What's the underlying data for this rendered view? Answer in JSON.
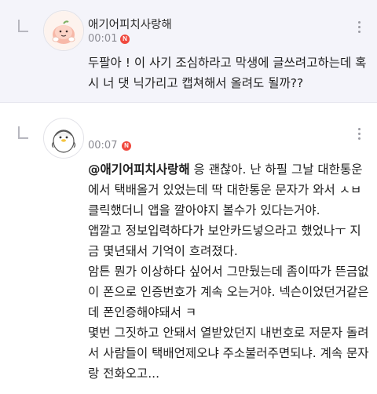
{
  "comments": [
    {
      "nickname": "애기어피치사랑해",
      "time": "00:01",
      "badge": "N",
      "text": "두팔아 ! 이 사기 조심하라고 막생에 글쓰려고하는데 혹시 너 댓 닉가리고 캡쳐해서 올려도 될까??",
      "avatar": "peach-character-avatar"
    },
    {
      "nickname": "",
      "time": "00:07",
      "badge": "N",
      "mention": "@애기어피치사랑해",
      "text": "  응 괜찮아. 난 하필 그날 대한통운에서 택배올거 있었는데 딱 대한통운 문자가 와서 ㅅㅂ 클릭했더니 앱을 깔아야지 볼수가 있다는거야.\n앱깔고 정보입력하다가 보안카드넣으라고 했었나ㅜ 지금 몇년돼서 기억이 흐려졌다.\n암튼 뭔가 이상하다 싶어서 그만뒀는데 좀이따가 뜬금없이 폰으로 인증번호가 계속 오는거야. 넥슨이었던거같은데 폰인증해야돼서 ㅋ\n몇번 그짓하고 안돼서 열받았던지 내번호로 저문자 돌려서 사람들이 택배언제오냐 주소불러주면되냐.  계속 문자랑 전화오고...",
      "avatar": "penguin-character-avatar"
    }
  ],
  "colors": {
    "badge": "#f0493e",
    "highlight_bg": "#f4f4fa"
  }
}
